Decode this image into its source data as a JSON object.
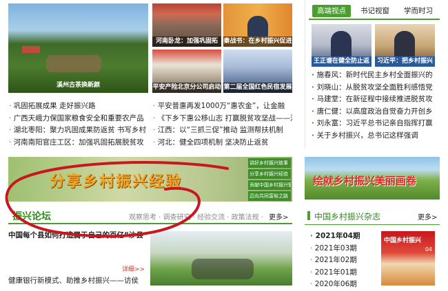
{
  "top_photos": {
    "main_caption": "溪州古茶换新颜",
    "p1": "河南卧龙：加强巩固拓",
    "p2": "秦战书：在乡村振兴促进",
    "p3": "平安产险北京分公司启动",
    "p4": "第二届全国红色民宿发展"
  },
  "left_news": [
    "巩固拓展成果 走好振兴路",
    "广西天峨力保国家粮食安全和重要农产品",
    "湖北枣阳：聚力巩固成果防返贫 书写乡村",
    "河南南阳官庄工区：加强巩固拓展脱贫攻"
  ],
  "mid_news": [
    "平安普惠再发1000万“惠农金”，让金融",
    "《下乡下惠公移山志 打赢脱贫攻坚战——河",
    "江西：以“三抓三促”推动 监测帮扶机制",
    "河北：健全四项机制 坚决防止返贫"
  ],
  "right_tabs": [
    "高端视点",
    "书记视窗",
    "学而时习"
  ],
  "right_photos": [
    "王正谱在健全防止返",
    "习近平：把乡村振兴"
  ],
  "right_news": [
    "施春风：新时代民主乡村全面振兴的",
    "刘晓山：从脱贫攻坚全面胜利感悟党",
    "马建堂：在新征程中接续推进脱贫攻",
    "唐仁健：以高度政治自觉奋力开创乡",
    "刘永富：习近平总书记亲自指挥打赢",
    "关于乡村振兴，总书记这样强调"
  ],
  "banner": {
    "title": "分享乡村振兴经验",
    "side_links": [
      "讲好乡村振兴故事",
      "分享乡村振兴经验",
      "贡献中国乡村振兴智慧",
      "迈向共同富裕之路"
    ]
  },
  "right_banner": {
    "title": "绘就乡村振兴美丽画卷"
  },
  "forum": {
    "title": "振兴论坛",
    "nav": "观察思考 · 调查研究 · 经验交流 · 政策法规 ·",
    "more": "更多>",
    "headline": "中国每个县如何打造属于自己的百亿“沙县",
    "detail": "详细>>",
    "bottom_item": "健康银行新模式、助推乡村振兴——访侯"
  },
  "magazine": {
    "title": "中国乡村振兴杂志",
    "more": "更多>",
    "issues": [
      "2021年04期",
      "2021年03期",
      "2021年02期",
      "2021年01期",
      "2020年06期"
    ],
    "cover_title": "中国乡村振兴",
    "cover_issue": "04"
  },
  "colors": {
    "accent_green": "#4a9e2d",
    "annotation_red": "#c8171e"
  }
}
